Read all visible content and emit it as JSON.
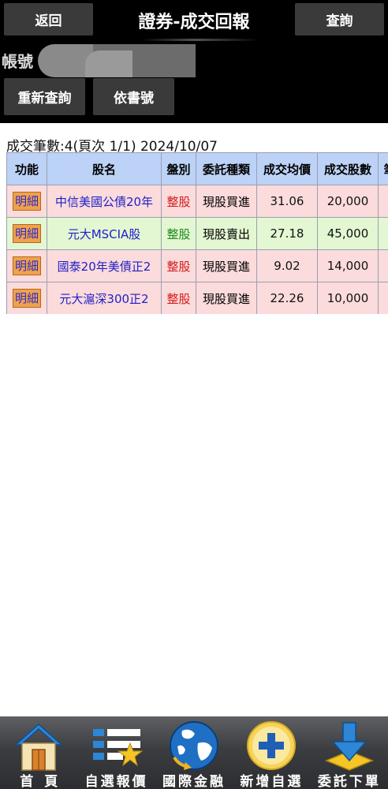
{
  "header": {
    "back_label": "返回",
    "title": "證券-成交回報",
    "query_label": "查詢",
    "account_label": "帳號",
    "requery_label": "重新查詢",
    "by_book_label": "依書號"
  },
  "summary": {
    "text": "成交筆數:4(頁次 1/1) 2024/10/07"
  },
  "table": {
    "headers": [
      "功能",
      "股名",
      "盤別",
      "委託種類",
      "成交均價",
      "成交股數",
      "筆"
    ],
    "rows": [
      {
        "detail": "明細",
        "name": "中信美國公債20年",
        "board": "整股",
        "order_type": "現股買進",
        "avg_price": "31.06",
        "shares": "20,000",
        "side": "buy"
      },
      {
        "detail": "明細",
        "name": "元大MSCIA股",
        "board": "整股",
        "order_type": "現股賣出",
        "avg_price": "27.18",
        "shares": "45,000",
        "side": "sell"
      },
      {
        "detail": "明細",
        "name": "國泰20年美債正2",
        "board": "整股",
        "order_type": "現股買進",
        "avg_price": "9.02",
        "shares": "14,000",
        "side": "buy"
      },
      {
        "detail": "明細",
        "name": "元大滬深300正2",
        "board": "整股",
        "order_type": "現股買進",
        "avg_price": "22.26",
        "shares": "10,000",
        "side": "buy"
      }
    ]
  },
  "bottom_nav": {
    "items": [
      {
        "label": "首頁",
        "icon": "home-icon"
      },
      {
        "label": "自選報價",
        "icon": "watchlist-quote-icon"
      },
      {
        "label": "國際金融",
        "icon": "globe-icon"
      },
      {
        "label": "新增自選",
        "icon": "add-watchlist-icon"
      },
      {
        "label": "委託下單",
        "icon": "place-order-icon"
      }
    ]
  },
  "colors": {
    "header_bg": "#000000",
    "button_bg": "#3a3a3a",
    "table_header_bg": "#bcd2f6",
    "buy_row_bg": "#fbdbdb",
    "sell_row_bg": "#e3f7d2",
    "detail_button_bg": "#f1a14a",
    "stock_name_color": "#1f1fc8"
  }
}
